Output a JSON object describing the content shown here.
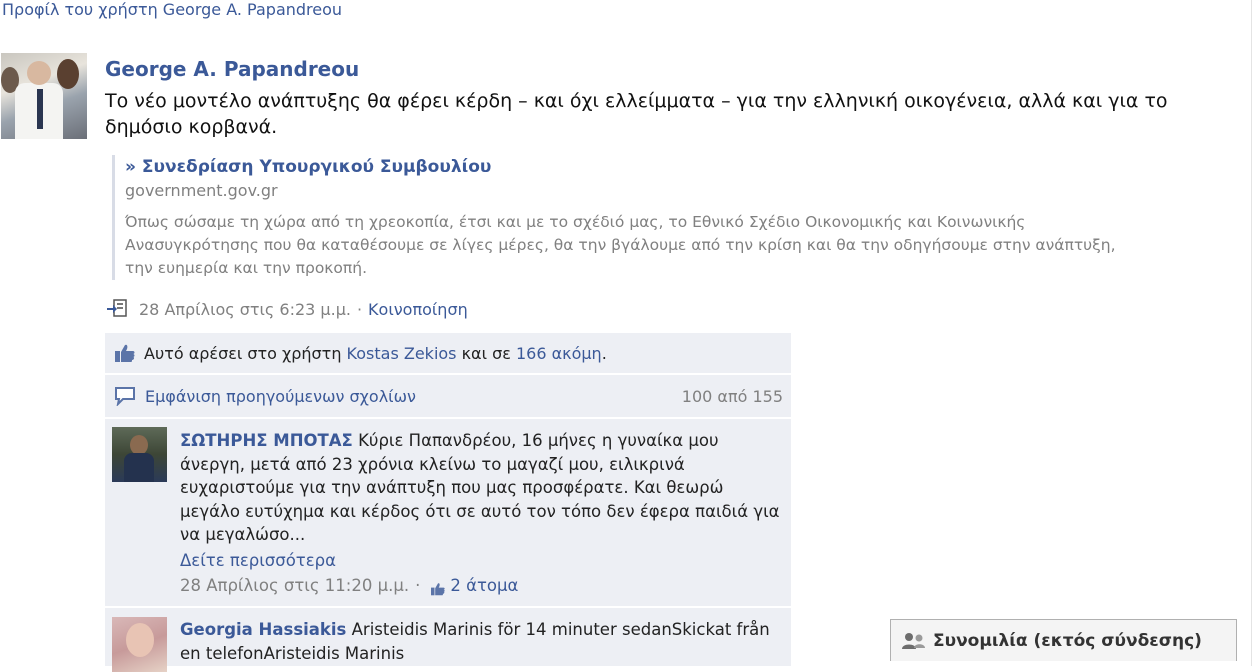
{
  "header": {
    "profile_link": "Προφίλ του χρήστη George A. Papandreou"
  },
  "post": {
    "author": "George A. Papandreou",
    "text": "Το νέο μοντέλο ανάπτυξης θα φέρει κέρδη – και όχι ελλείμματα – για την ελληνική οικογένεια, αλλά και για το δημόσιο κορβανά.",
    "attachment": {
      "title": "» Συνεδρίαση Υπουργικού Συμβουλίου",
      "domain": "government.gov.gr",
      "description": "Όπως σώσαμε τη χώρα από τη χρεοκοπία, έτσι και με το σχέδιό μας, το Εθνικό Σχέδιο Οικονομικής και Κοινωνικής Ανασυγκρότησης που θα καταθέσουμε σε λίγες μέρες, θα την βγάλουμε από την κρίση και θα την οδηγήσουμε στην ανάπτυξη, την ευημερία και την προκοπή."
    },
    "timestamp": "28 Απρίλιος στις 6:23 μ.μ.",
    "separator": "·",
    "share_label": "Κοινοποίηση",
    "icons": {
      "attachment_type": "share-link-icon"
    }
  },
  "likes": {
    "prefix": "Αυτό αρέσει στο χρήστη",
    "user": "Kostas Zekios",
    "conjunction": "και σε",
    "others": "166 ακόμη",
    "suffix": ".",
    "icon": "thumbs-up-icon"
  },
  "comments_bar": {
    "label": "Εμφάνιση προηγούμενων σχολίων",
    "count": "100 από 155",
    "icon": "speech-bubble-icon"
  },
  "comments": [
    {
      "author": "ΣΩΤΗΡΗΣ ΜΠΟΤΑΣ",
      "text": "Κύριε Παπανδρέου, 16 μήνες η γυναίκα μου άνεργη, μετά από 23 χρόνια κλείνω το μαγαζί μου, ειλικρινά ευχαριστούμε για την ανάπτυξη που μας προσφέρατε. Και θεωρώ μεγάλο ευτύχημα και κέρδος ότι σε αυτό τον τόπο δεν έφερα παιδιά για να μεγαλώσο...",
      "see_more": "Δείτε περισσότερα",
      "timestamp": "28 Απρίλιος στις 11:20 μ.μ.",
      "separator": "·",
      "likes": "2 άτομα"
    },
    {
      "author": "Georgia Hassiakis",
      "text": "Aristeidis Marinis för 14 minuter sedanSkickat från en telefonAristeidis Marinis"
    }
  ],
  "chat": {
    "label": "Συνομιλία (εκτός σύνδεσης)",
    "icon": "chat-users-icon"
  },
  "colors": {
    "link": "#3b5998",
    "feed_bg": "#edeff4",
    "muted": "#808080"
  }
}
